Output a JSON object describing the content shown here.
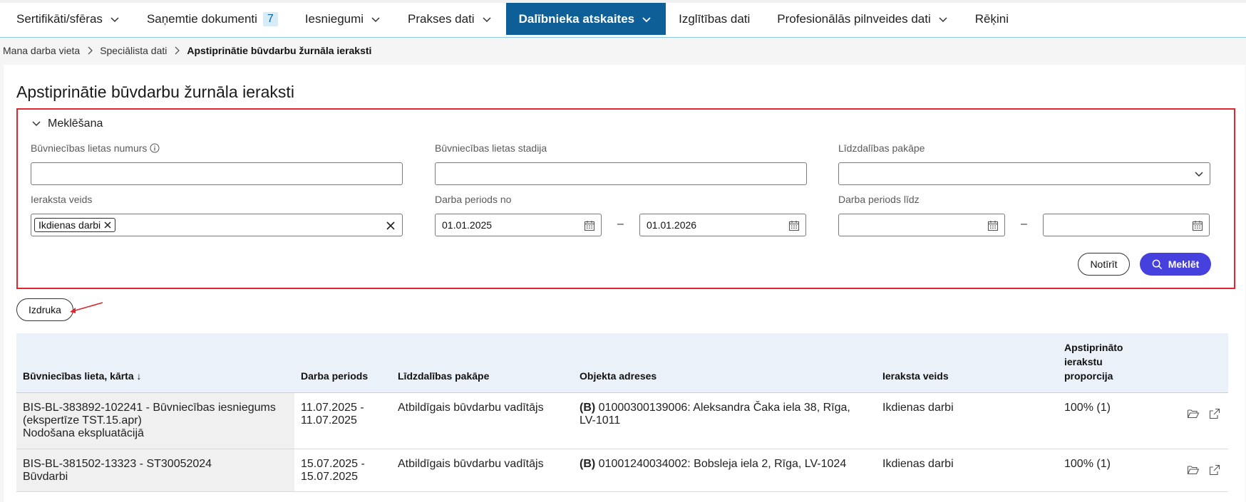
{
  "nav": {
    "items": [
      {
        "label": "Sertifikāti/sfēras",
        "chevron": true
      },
      {
        "label": "Saņemtie dokumenti",
        "badge": "7"
      },
      {
        "label": "Iesniegumi",
        "chevron": true
      },
      {
        "label": "Prakses dati",
        "chevron": true
      },
      {
        "label": "Dalībnieka atskaites",
        "chevron": true,
        "active": true
      },
      {
        "label": "Izglītības dati"
      },
      {
        "label": "Profesionālās pilnveides dati",
        "chevron": true
      },
      {
        "label": "Rēķini"
      }
    ]
  },
  "breadcrumb": [
    "Mana darba vieta",
    "Speciālista dati",
    "Apstiprinātie būvdarbu žurnāla ieraksti"
  ],
  "page": {
    "title": "Apstiprinātie būvdarbu žurnāla ieraksti"
  },
  "search": {
    "toggle_label": "Meklēšana",
    "case_number_label": "Būvniecības lietas numurs",
    "case_number_value": "",
    "case_stage_label": "Būvniecības lietas stadija",
    "case_stage_value": "",
    "participation_label": "Līdzdalības pakāpe",
    "participation_value": "",
    "entry_type_label": "Ieraksta veids",
    "entry_type_chip": "Ikdienas darbi",
    "period_from_label": "Darba periods no",
    "period_from_start": "01.01.2025",
    "period_from_end": "01.01.2026",
    "period_to_label": "Darba periods līdz",
    "period_to_start": "",
    "period_to_end": "",
    "range_dash": "–",
    "clear_button": "Notīrīt",
    "search_button": "Meklēt"
  },
  "print_button": "Izdruka",
  "table": {
    "headers": {
      "case": "Būvniecības lieta, kārta ↓",
      "period": "Darba periods",
      "participation": "Līdzdalības pakāpe",
      "address": "Objekta adreses",
      "entry_type": "Ieraksta veids",
      "proportion": "Apstiprināto ierakstu proporcija"
    },
    "rows": [
      {
        "case_line1": "BIS-BL-383892-102241 - Būvniecības iesniegums (ekspertīze TST.15.apr)",
        "case_line2": "Nodošana ekspluatācijā",
        "period": "11.07.2025 - 11.07.2025",
        "participation": "Atbildīgais būvdarbu vadītājs",
        "address_tag": "(B)",
        "address": "01000300139006: Aleksandra Čaka iela 38, Rīga, LV-1011",
        "entry_type": "Ikdienas darbi",
        "proportion": "100% (1)"
      },
      {
        "case_line1": "BIS-BL-381502-13323 - ST30052024",
        "case_line2": "Būvdarbi",
        "period": "15.07.2025 - 15.07.2025",
        "participation": "Atbildīgais būvdarbu vadītājs",
        "address_tag": "(B)",
        "address": "01001240034002: Bobsleja iela 2, Rīga, LV-1024",
        "entry_type": "Ikdienas darbi",
        "proportion": "100% (1)"
      }
    ]
  },
  "colors": {
    "nav_active": "#0e5f97",
    "primary": "#4640de",
    "highlight_border": "#e0262e"
  }
}
